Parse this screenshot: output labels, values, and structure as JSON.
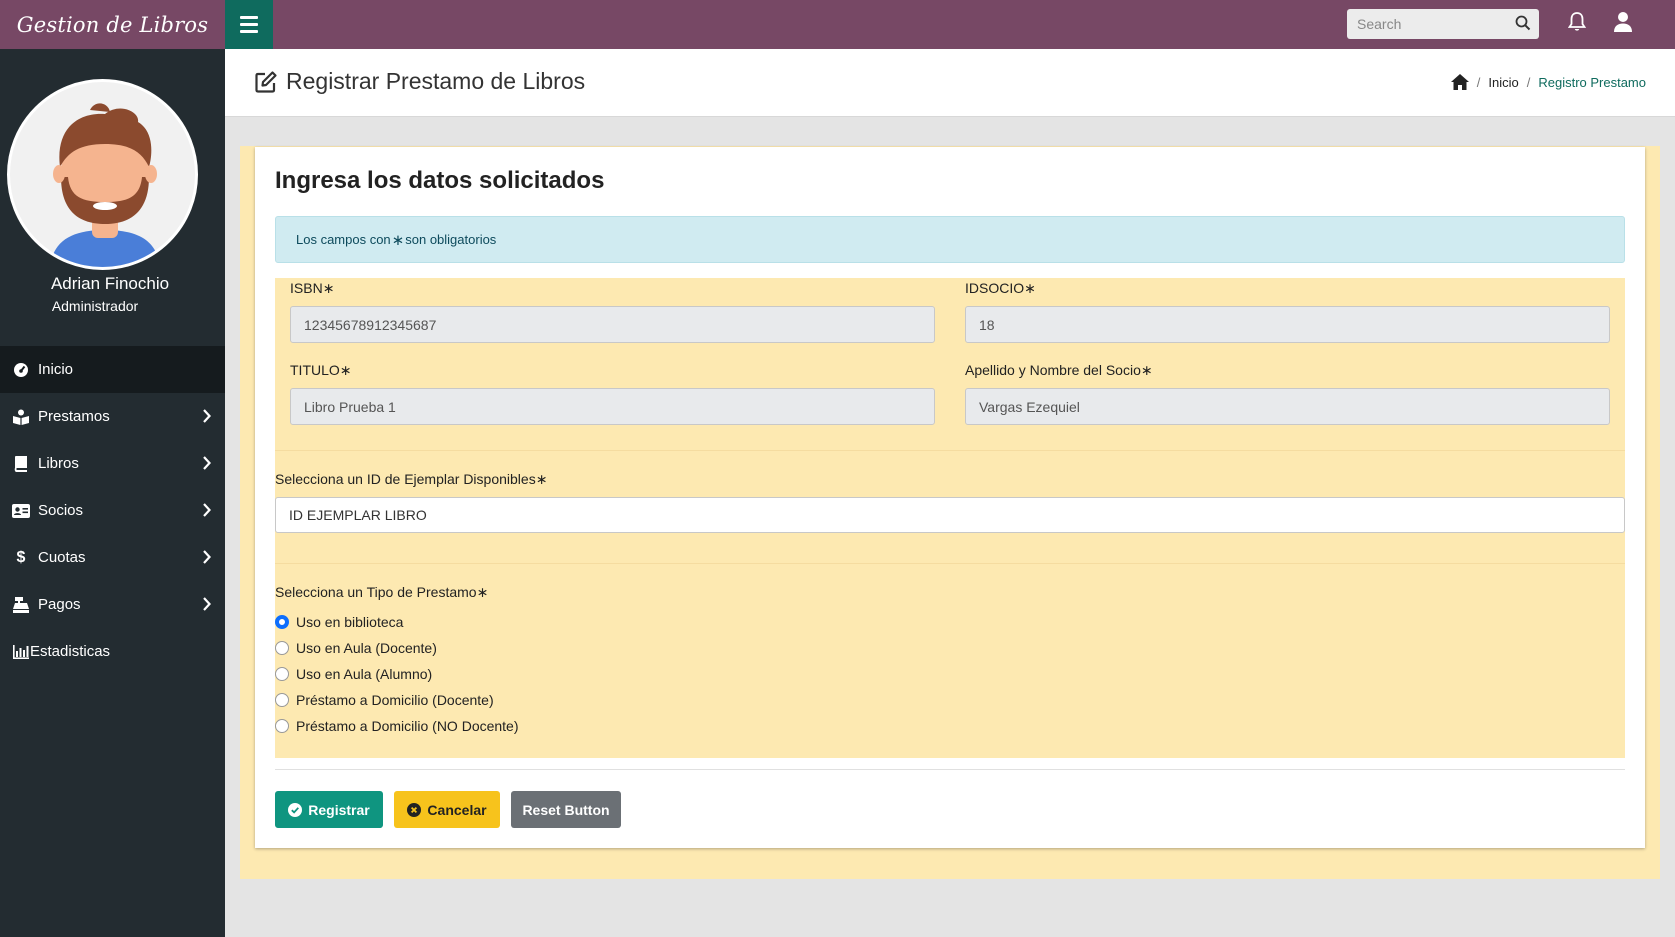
{
  "brand": "Gestion de Libros",
  "search": {
    "placeholder": "Search"
  },
  "sidebar": {
    "user_name": "Adrian Finochio",
    "user_role": "Administrador",
    "items": [
      {
        "label": "Inicio",
        "icon": "dashboard-icon",
        "active": true
      },
      {
        "label": "Prestamos",
        "icon": "reader-icon",
        "has_submenu": true
      },
      {
        "label": "Libros",
        "icon": "book-icon",
        "has_submenu": true
      },
      {
        "label": "Socios",
        "icon": "id-card-icon",
        "has_submenu": true
      },
      {
        "label": "Cuotas",
        "icon": "dollar-icon",
        "has_submenu": true
      },
      {
        "label": "Pagos",
        "icon": "cash-register-icon",
        "has_submenu": true
      },
      {
        "label": "Estadisticas",
        "icon": "chart-icon"
      }
    ]
  },
  "header": {
    "title": "Registrar Prestamo de Libros",
    "breadcrumb": {
      "home_icon": "home-icon",
      "link": "Inicio",
      "current": "Registro Prestamo"
    }
  },
  "form": {
    "heading": "Ingresa los datos solicitados",
    "alert": {
      "before": "Los campos con",
      "after": "son obligatorios"
    },
    "isbn": {
      "label": "ISBN",
      "value": "12345678912345687"
    },
    "idsocio": {
      "label": "IDSOCIO",
      "value": "18"
    },
    "titulo": {
      "label": "TITULO",
      "value": "Libro Prueba 1"
    },
    "socio_nombre": {
      "label": "Apellido y Nombre del Socio",
      "value": "Vargas Ezequiel"
    },
    "ejemplar": {
      "label": "Selecciona un ID de Ejemplar Disponibles",
      "value": "ID EJEMPLAR LIBRO"
    },
    "tipo": {
      "label": "Selecciona un Tipo de Prestamo",
      "options": [
        {
          "label": "Uso en biblioteca",
          "checked": true
        },
        {
          "label": "Uso en Aula (Docente)",
          "checked": false
        },
        {
          "label": "Uso en Aula (Alumno)",
          "checked": false
        },
        {
          "label": "Préstamo a Domicilio (Docente)",
          "checked": false
        },
        {
          "label": "Préstamo a Domicilio (NO Docente)",
          "checked": false
        }
      ]
    },
    "required_mark": "∗"
  },
  "buttons": {
    "registrar": "Registrar",
    "cancelar": "Cancelar",
    "reset": "Reset Button"
  },
  "colors": {
    "topbar": "#774865",
    "toggle": "#0f6b5e",
    "sidebar": "#232c31",
    "form_bg": "#fde9b1",
    "primary": "#0f9580",
    "warning": "#f7c31c",
    "secondary": "#6b7075"
  }
}
